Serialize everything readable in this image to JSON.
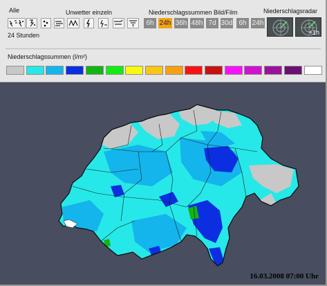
{
  "header": {
    "all_label": "Alle",
    "severe_weather_label": "Unwetter einzeln",
    "precip_totals_label": "Niederschlagssummen Bild/Film",
    "precip_radar_label": "Niederschlagsradar",
    "hours_label": "24 Stunden"
  },
  "time_buttons": [
    {
      "label": "6h",
      "active": false
    },
    {
      "label": "24h",
      "active": true
    },
    {
      "label": "36h",
      "active": false
    },
    {
      "label": "48h",
      "active": false
    },
    {
      "label": "7d",
      "active": false
    },
    {
      "label": "30d",
      "active": false
    },
    {
      "label": "6h",
      "active": false
    },
    {
      "label": "24h",
      "active": false
    }
  ],
  "weather_icons": [
    "multi-weather-icon",
    "lightning-hail-icon",
    "rain-drops-icon",
    "wind-icon",
    "storm-icon",
    "lightning-icon",
    "thunderstorm-icon",
    "gust-icon",
    "tornado-icon"
  ],
  "radar": {
    "thumbnail_1": "radar-icon",
    "thumbnail_2_label": "+1h"
  },
  "legend": {
    "title": "Niederschlagssummen (l/m²)",
    "colors": [
      "#c8c8c8",
      "#27e8e8",
      "#13b5ec",
      "#0a2ee0",
      "#13b414",
      "#13ec13",
      "#f8f812",
      "#f8c614",
      "#f8a012",
      "#f81212",
      "#c81212",
      "#f812f8",
      "#d012d0",
      "#9a129a",
      "#6a1070",
      "#ffffff"
    ]
  },
  "map": {
    "background_color": "#484e60",
    "timestamp": "16.03.2008 07:00 Uhr"
  }
}
